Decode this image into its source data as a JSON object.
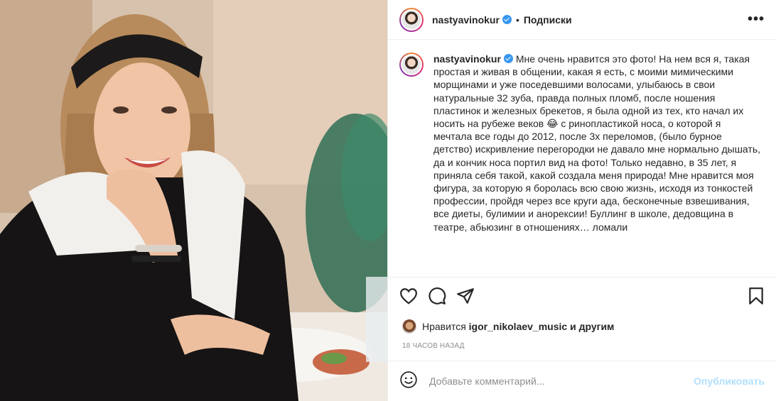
{
  "post": {
    "username": "nastyavinokur",
    "verified_icon": "verified-badge-icon",
    "separator": "•",
    "follow_label": "Подписки",
    "more_icon": "more-options-icon",
    "more_label": "•••",
    "caption": "Мне очень нравится это фото! На нем вся я, такая простая и живая в общении, какая я есть, с моими мимическими морщинами и уже поседевшими волосами, улыбаюсь в свои натуральные 32 зуба, правда полных пломб, после ношения пластинок и железных брекетов, я была одной из тех, кто начал их носить на рубеже веков 😂 с ринопластикой носа, о которой я мечтала все годы до 2012, после 3х переломов, (было бурное детство) искривление перегородки не давало мне нормально дышать, да и кончик носа портил вид на фото! Только недавно, в 35 лет, я приняла себя такой, какой создала меня природа! Мне нравится моя фигура, за которую я боролась всю свою жизнь, исходя из тонкостей профессии, пройдя через все круги ада, бесконечные взвешивания, все диеты, булимии и анорексии! Буллинг в школе, дедовщина в театре, абьюзинг в отношениях… ломали"
  },
  "actions": {
    "like_icon": "heart-icon",
    "comment_icon": "comment-icon",
    "share_icon": "share-icon",
    "save_icon": "bookmark-icon"
  },
  "likes": {
    "prefix": "Нравится",
    "user": "igor_nikolaev_music",
    "suffix": "и другим"
  },
  "timestamp": "18 ЧАСОВ НАЗАД",
  "comment": {
    "emoji_icon": "emoji-icon",
    "placeholder": "Добавьте комментарий...",
    "publish_label": "Опубликовать"
  },
  "colors": {
    "accent": "#3897f0",
    "publish_disabled": "#b2dffc",
    "muted": "#8e8e8e"
  }
}
